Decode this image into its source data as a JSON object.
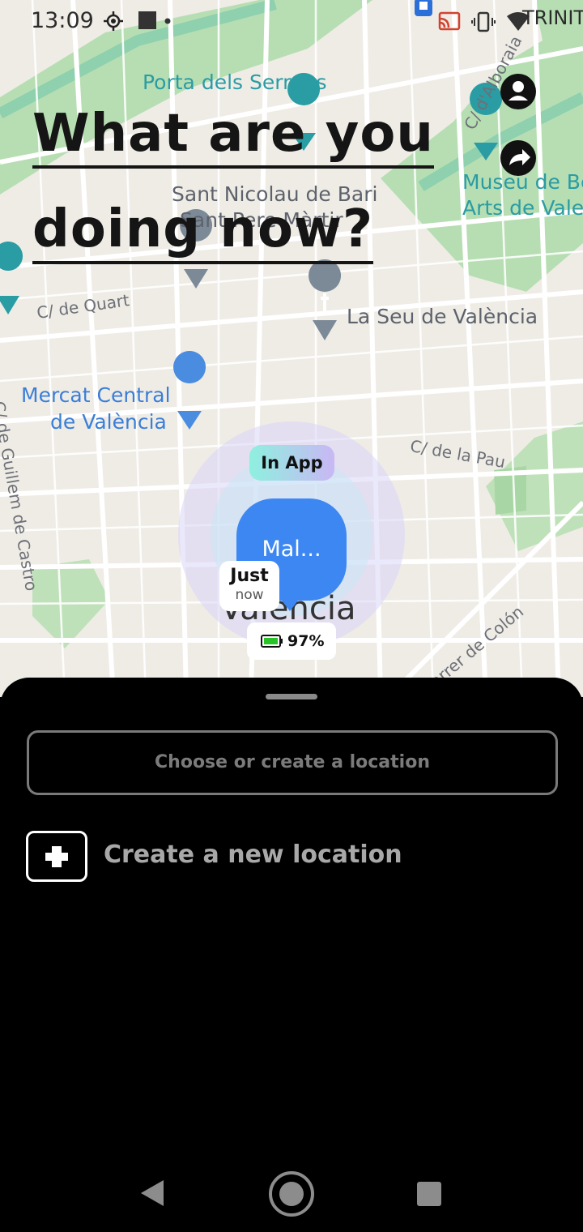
{
  "status_bar": {
    "time": "13:09",
    "carrier": "TRINIT"
  },
  "headline": {
    "line1": "What are you",
    "line2": "doing now?"
  },
  "map": {
    "labels": {
      "porta": "Porta dels Serrans",
      "sant_nicolau": "Sant Nicolau de Bari",
      "sant_pere": "Sant Pere Màrtir",
      "quart": "C/ de Quart",
      "seu": "La Seu de València",
      "mercat_1": "Mercat Central",
      "mercat_2": "de València",
      "pau": "C/ de la Pau",
      "guillem": "C/ de Guillem de Castro",
      "alboraia": "C/ d'Alboraia",
      "museu_1": "Museu de Be",
      "museu_2": "Arts de Vale",
      "colon": "Carrer de Colón",
      "valencia": "València"
    }
  },
  "marker": {
    "badge": "In App",
    "name": "Mal...",
    "time_line1": "Just",
    "time_line2": "now",
    "battery": "97%"
  },
  "sheet": {
    "choose_placeholder": "Choose or create a location",
    "create_label": "Create a new location"
  },
  "colors": {
    "accent_blue": "#3d87f3",
    "park_green": "#b9dfb7",
    "sheet_bg": "#000000"
  }
}
